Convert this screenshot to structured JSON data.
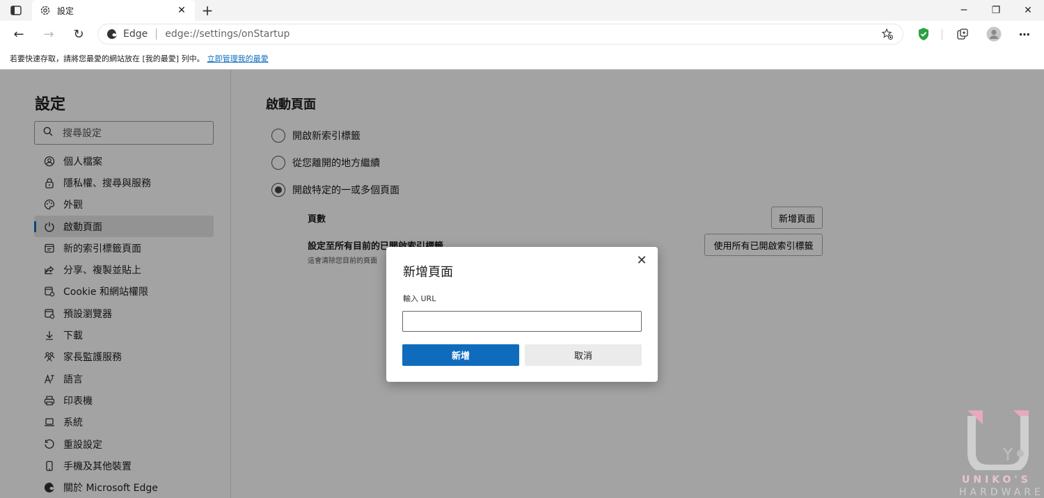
{
  "browser": {
    "tab_title": "設定",
    "omnibox_site": "Edge",
    "omnibox_url": "edge://settings/onStartup",
    "favorites_hint": "若要快速存取，請將您最愛的網站放在 [我的最愛] 列中。",
    "favorites_link": "立即管理我的最愛"
  },
  "sidebar": {
    "title": "設定",
    "search_placeholder": "搜尋設定",
    "items": [
      {
        "label": "個人檔案",
        "icon": "profile-icon"
      },
      {
        "label": "隱私權、搜尋與服務",
        "icon": "lock-icon"
      },
      {
        "label": "外觀",
        "icon": "palette-icon"
      },
      {
        "label": "啟動頁面",
        "icon": "power-icon",
        "active": true
      },
      {
        "label": "新的索引標籤頁面",
        "icon": "newtab-icon"
      },
      {
        "label": "分享、複製並貼上",
        "icon": "share-icon"
      },
      {
        "label": "Cookie 和網站權限",
        "icon": "cookie-icon"
      },
      {
        "label": "預設瀏覽器",
        "icon": "browser-icon"
      },
      {
        "label": "下載",
        "icon": "download-icon"
      },
      {
        "label": "家長監護服務",
        "icon": "family-icon"
      },
      {
        "label": "語言",
        "icon": "language-icon"
      },
      {
        "label": "印表機",
        "icon": "printer-icon"
      },
      {
        "label": "系統",
        "icon": "laptop-icon"
      },
      {
        "label": "重設設定",
        "icon": "reset-icon"
      },
      {
        "label": "手機及其他裝置",
        "icon": "phone-icon"
      },
      {
        "label": "關於 Microsoft Edge",
        "icon": "edge-icon"
      }
    ]
  },
  "main": {
    "heading": "啟動頁面",
    "options": [
      {
        "label": "開啟新索引標籤",
        "checked": false
      },
      {
        "label": "從您離開的地方繼續",
        "checked": false
      },
      {
        "label": "開啟特定的一或多個頁面",
        "checked": true
      }
    ],
    "pages_label": "頁數",
    "add_page_button": "新增頁面",
    "set_all_label": "設定至所有目前的已開啟索引標籤",
    "set_all_sub": "這會清除您目前的頁面",
    "use_all_tabs_button": "使用所有已開啟索引標籤"
  },
  "dialog": {
    "title": "新增頁面",
    "input_label": "輸入 URL",
    "input_value": "",
    "confirm_button": "新增",
    "cancel_button": "取消"
  },
  "watermark": {
    "line1": "UNIKO'S",
    "line2": "HARDWARE"
  },
  "colors": {
    "accent": "#0f6cbd",
    "shield": "#2ea043",
    "watermark_pink": "#e8a9bb"
  }
}
